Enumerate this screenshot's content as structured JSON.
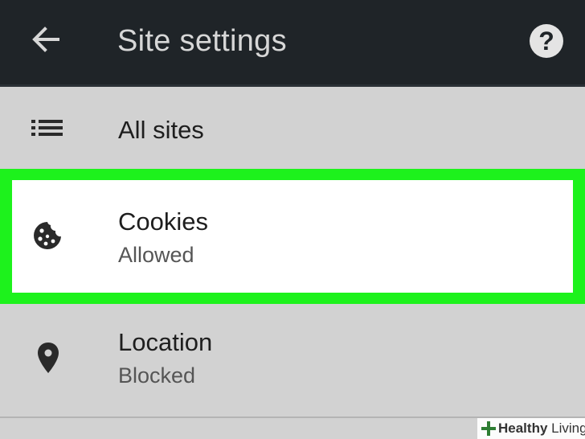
{
  "header": {
    "title": "Site settings",
    "back_icon": "arrow-left-icon",
    "help_icon": "help-circle-icon",
    "help_glyph": "?"
  },
  "items": [
    {
      "id": "all-sites",
      "label": "All sites",
      "icon": "list-icon"
    },
    {
      "id": "cookies",
      "label": "Cookies",
      "status": "Allowed",
      "icon": "cookie-icon",
      "highlighted": true,
      "highlight_color": "#1df21c"
    },
    {
      "id": "location",
      "label": "Location",
      "status": "Blocked",
      "icon": "location-pin-icon"
    }
  ],
  "watermark": {
    "brand_strong": "Healthy",
    "brand_rest": " Living",
    "icon": "plus-icon"
  },
  "colors": {
    "header_bg": "#1f2428",
    "list_bg": "#d2d2d2",
    "highlight": "#1df21c",
    "selected_bg": "#ffffff",
    "icon": "#2a2a2a"
  }
}
